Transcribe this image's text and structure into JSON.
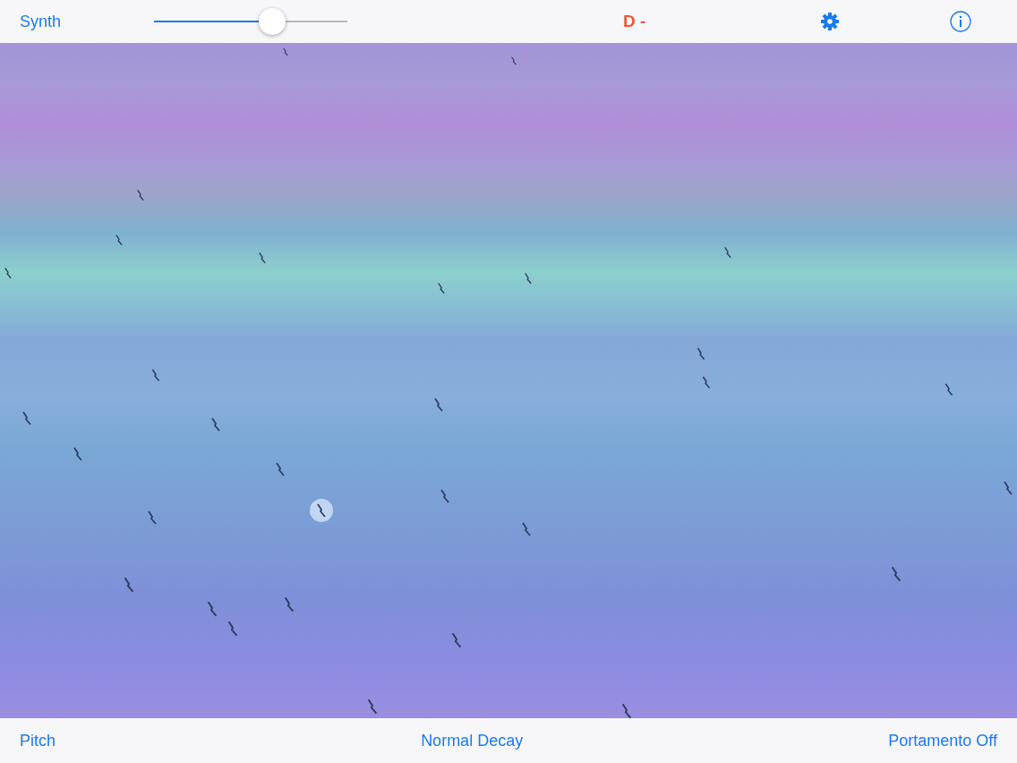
{
  "toolbar": {
    "instrument": "Synth",
    "volume": {
      "level": 0.61
    },
    "note": "D -"
  },
  "bottom_bar": {
    "left": "Pitch",
    "center": "Normal Decay",
    "right": "Portamento Off"
  }
}
